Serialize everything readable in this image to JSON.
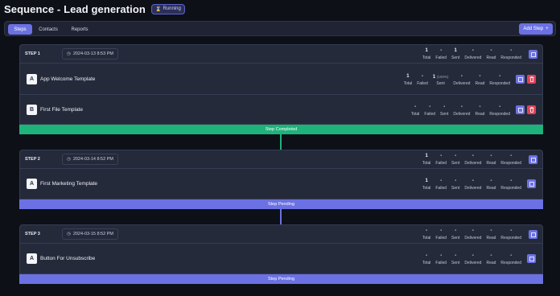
{
  "sequence": {
    "title": "Sequence - Lead generation",
    "status": "Running"
  },
  "tabs": [
    {
      "label": "Steps",
      "active": true
    },
    {
      "label": "Contacts",
      "active": false
    },
    {
      "label": "Reports",
      "active": false
    }
  ],
  "add_step_label": "Add Step",
  "stat_labels": [
    "Total",
    "Failed",
    "Sent",
    "Delivered",
    "Read",
    "Responded"
  ],
  "colors": {
    "accent": "#6b71e3",
    "success": "#1db37a",
    "danger": "#e04358"
  },
  "steps": [
    {
      "label": "STEP 1",
      "date": "2024-03-13 8:53 PM",
      "stats": {
        "total": "1",
        "failed": "-",
        "sent": "1",
        "delivered": "-",
        "read": "-",
        "responded": "-"
      },
      "templates": [
        {
          "icon": "A",
          "name": "App Welcome Template",
          "stats": {
            "total": "1",
            "failed": "-",
            "sent": "1",
            "sent_pct": "(100%)",
            "delivered": "-",
            "read": "-",
            "responded": "-"
          }
        },
        {
          "icon": "B",
          "name": "First File Template",
          "stats": {
            "total": "-",
            "failed": "-",
            "sent": "-",
            "delivered": "-",
            "read": "-",
            "responded": "-"
          }
        }
      ],
      "status": "Step Completed"
    },
    {
      "label": "STEP 2",
      "date": "2024-03-14 8:52 PM",
      "stats": {
        "total": "1",
        "failed": "-",
        "sent": "-",
        "delivered": "-",
        "read": "-",
        "responded": "-"
      },
      "templates": [
        {
          "icon": "A",
          "name": "First Marketing Template",
          "stats": {
            "total": "1",
            "failed": "-",
            "sent": "-",
            "delivered": "-",
            "read": "-",
            "responded": "-"
          }
        }
      ],
      "status": "Step Pending"
    },
    {
      "label": "STEP 3",
      "date": "2024-03-15 8:52 PM",
      "stats": {
        "total": "-",
        "failed": "-",
        "sent": "-",
        "delivered": "-",
        "read": "-",
        "responded": "-"
      },
      "templates": [
        {
          "icon": "A",
          "name": "Button For Unsubscribe",
          "stats": {
            "total": "-",
            "failed": "-",
            "sent": "-",
            "delivered": "-",
            "read": "-",
            "responded": "-"
          }
        }
      ],
      "status": "Step Pending"
    }
  ]
}
